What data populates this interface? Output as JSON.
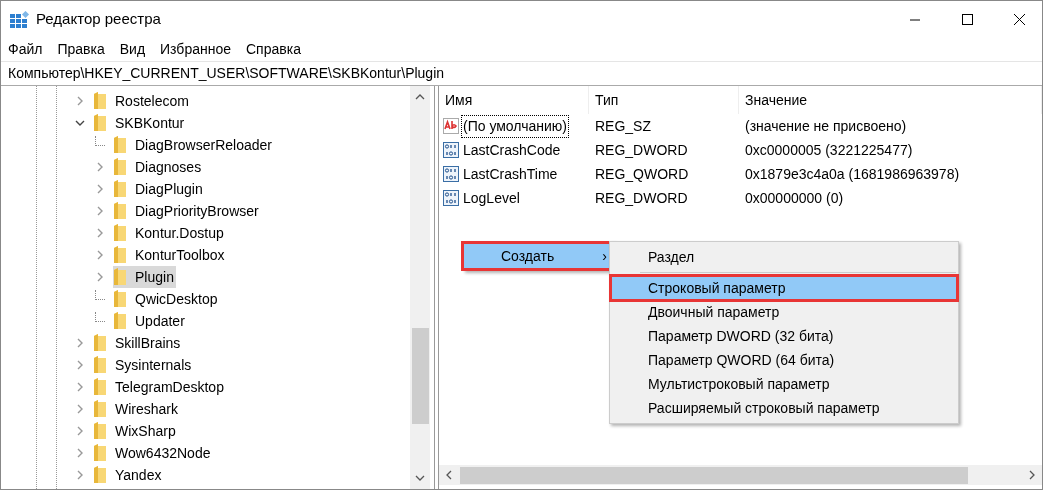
{
  "window": {
    "title": "Редактор реестра"
  },
  "menu_bar": [
    "Файл",
    "Правка",
    "Вид",
    "Избранное",
    "Справка"
  ],
  "address": "Компьютер\\HKEY_CURRENT_USER\\SOFTWARE\\SKBKontur\\Plugin",
  "tree": [
    {
      "label": "Rostelecom",
      "expandable": true,
      "expanded": false,
      "selected": false
    },
    {
      "label": "SKBKontur",
      "expandable": true,
      "expanded": true,
      "selected": false,
      "children": [
        {
          "label": "DiagBrowserReloader",
          "expandable": false,
          "selected": false
        },
        {
          "label": "Diagnoses",
          "expandable": true,
          "expanded": false,
          "selected": false
        },
        {
          "label": "DiagPlugin",
          "expandable": true,
          "expanded": false,
          "selected": false
        },
        {
          "label": "DiagPriorityBrowser",
          "expandable": true,
          "expanded": false,
          "selected": false
        },
        {
          "label": "Kontur.Dostup",
          "expandable": true,
          "expanded": false,
          "selected": false
        },
        {
          "label": "KonturToolbox",
          "expandable": true,
          "expanded": false,
          "selected": false
        },
        {
          "label": "Plugin",
          "expandable": true,
          "expanded": false,
          "selected": true
        },
        {
          "label": "QwicDesktop",
          "expandable": false,
          "selected": false
        },
        {
          "label": "Updater",
          "expandable": false,
          "selected": false
        }
      ]
    },
    {
      "label": "SkillBrains",
      "expandable": true,
      "expanded": false,
      "selected": false
    },
    {
      "label": "Sysinternals",
      "expandable": true,
      "expanded": false,
      "selected": false
    },
    {
      "label": "TelegramDesktop",
      "expandable": true,
      "expanded": false,
      "selected": false
    },
    {
      "label": "Wireshark",
      "expandable": true,
      "expanded": false,
      "selected": false
    },
    {
      "label": "WixSharp",
      "expandable": true,
      "expanded": false,
      "selected": false
    },
    {
      "label": "Wow6432Node",
      "expandable": true,
      "expanded": false,
      "selected": false
    },
    {
      "label": "Yandex",
      "expandable": true,
      "expanded": false,
      "selected": false
    }
  ],
  "table": {
    "columns": [
      "Имя",
      "Тип",
      "Значение"
    ],
    "rows": [
      {
        "kind": "string",
        "name": "(По умолчанию)",
        "type": "REG_SZ",
        "value": "(значение не присвоено)",
        "focused": true
      },
      {
        "kind": "binary",
        "name": "LastCrashCode",
        "type": "REG_DWORD",
        "value": "0xc0000005 (3221225477)",
        "focused": false
      },
      {
        "kind": "binary",
        "name": "LastCrashTime",
        "type": "REG_QWORD",
        "value": "0x1879e3c4a0a (1681986963978)",
        "focused": false
      },
      {
        "kind": "binary",
        "name": "LogLevel",
        "type": "REG_DWORD",
        "value": "0x00000000 (0)",
        "focused": false
      }
    ]
  },
  "context_menu": {
    "label": "Создать",
    "arrow": "›",
    "selected": true,
    "outlined": true
  },
  "submenu": [
    {
      "label": "Раздел",
      "selected": false,
      "outlined": false,
      "separator_after": true
    },
    {
      "label": "Строковый параметр",
      "selected": true,
      "outlined": true,
      "separator_after": false
    },
    {
      "label": "Двоичный параметр",
      "selected": false,
      "outlined": false,
      "separator_after": false
    },
    {
      "label": "Параметр DWORD (32 бита)",
      "selected": false,
      "outlined": false,
      "separator_after": false
    },
    {
      "label": "Параметр QWORD (64 бита)",
      "selected": false,
      "outlined": false,
      "separator_after": false
    },
    {
      "label": "Мультистроковый параметр",
      "selected": false,
      "outlined": false,
      "separator_after": false
    },
    {
      "label": "Расширяемый строковый параметр",
      "selected": false,
      "outlined": false,
      "separator_after": false
    }
  ]
}
